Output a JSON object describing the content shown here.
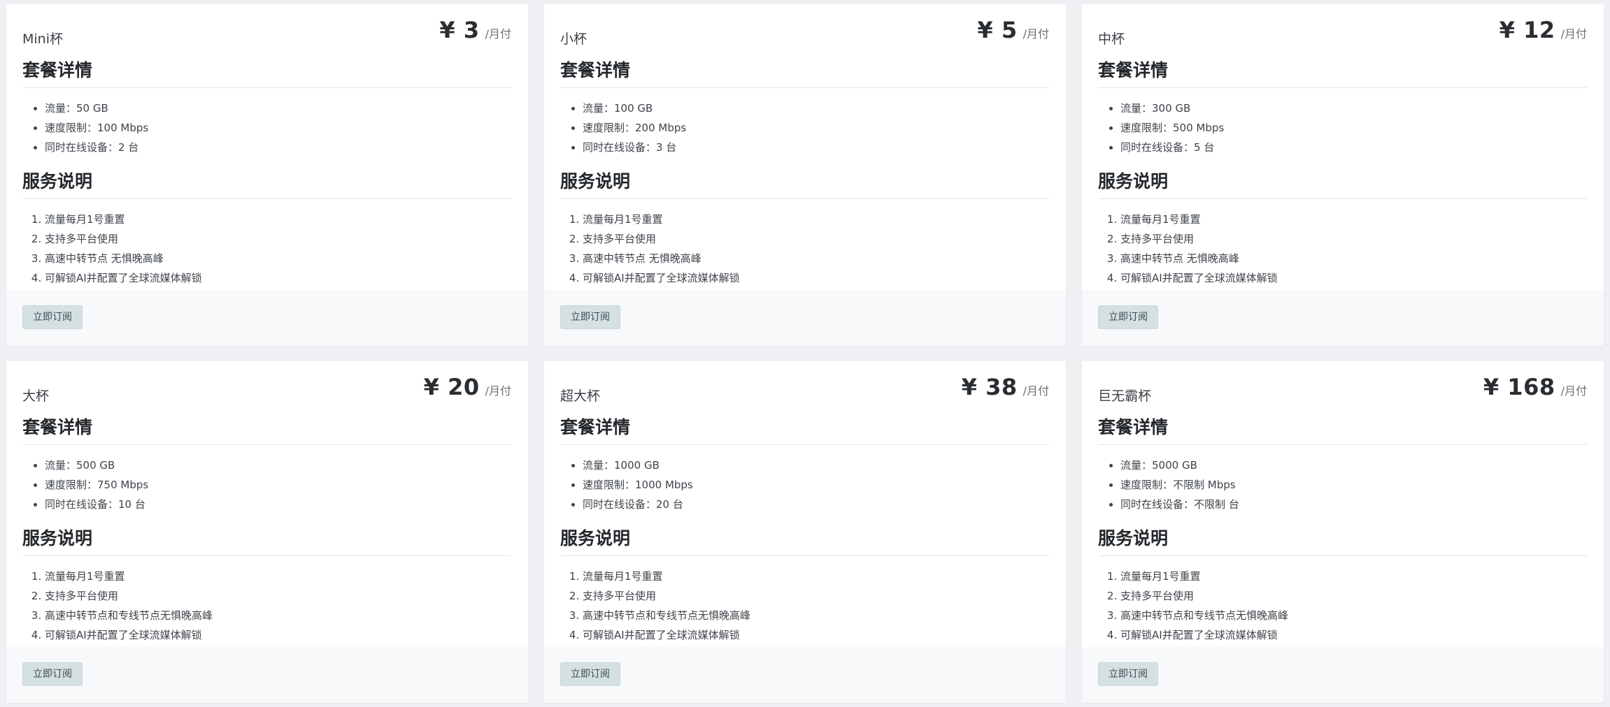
{
  "labels": {
    "currency": "¥",
    "period": "/月付",
    "details_title": "套餐详情",
    "services_title": "服务说明",
    "subscribe": "立即订阅"
  },
  "plans": [
    {
      "name": "Mini杯",
      "price": "¥ 3",
      "details": [
        "流量：50 GB",
        "速度限制：100 Mbps",
        "同时在线设备：2 台"
      ],
      "services": [
        "流量每月1号重置",
        "支持多平台使用",
        "高速中转节点 无惧晚高峰",
        "可解锁AI并配置了全球流媒体解锁"
      ]
    },
    {
      "name": "小杯",
      "price": "¥ 5",
      "details": [
        "流量：100 GB",
        "速度限制：200 Mbps",
        "同时在线设备：3 台"
      ],
      "services": [
        "流量每月1号重置",
        "支持多平台使用",
        "高速中转节点 无惧晚高峰",
        "可解锁AI并配置了全球流媒体解锁"
      ]
    },
    {
      "name": "中杯",
      "price": "¥ 12",
      "details": [
        "流量：300 GB",
        "速度限制：500 Mbps",
        "同时在线设备：5 台"
      ],
      "services": [
        "流量每月1号重置",
        "支持多平台使用",
        "高速中转节点 无惧晚高峰",
        "可解锁AI并配置了全球流媒体解锁"
      ]
    },
    {
      "name": "大杯",
      "price": "¥ 20",
      "details": [
        "流量：500 GB",
        "速度限制：750 Mbps",
        "同时在线设备：10 台"
      ],
      "services": [
        "流量每月1号重置",
        "支持多平台使用",
        "高速中转节点和专线节点无惧晚高峰",
        "可解锁AI并配置了全球流媒体解锁"
      ]
    },
    {
      "name": "超大杯",
      "price": "¥ 38",
      "details": [
        "流量：1000 GB",
        "速度限制：1000 Mbps",
        "同时在线设备：20 台"
      ],
      "services": [
        "流量每月1号重置",
        "支持多平台使用",
        "高速中转节点和专线节点无惧晚高峰",
        "可解锁AI并配置了全球流媒体解锁"
      ]
    },
    {
      "name": "巨无霸杯",
      "price": "¥ 168",
      "details": [
        "流量：5000 GB",
        "速度限制：不限制 Mbps",
        "同时在线设备：不限制 台"
      ],
      "services": [
        "流量每月1号重置",
        "支持多平台使用",
        "高速中转节点和专线节点无惧晚高峰",
        "可解锁AI并配置了全球流媒体解锁"
      ]
    }
  ]
}
